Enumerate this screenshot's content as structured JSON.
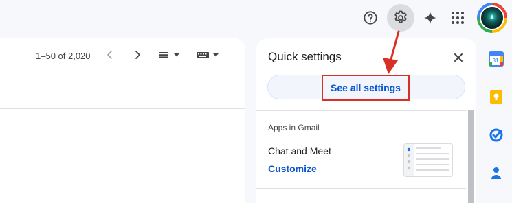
{
  "header": {
    "help_icon": "help-circle-icon",
    "settings_icon": "gear-icon",
    "gemini_icon": "sparkle-icon",
    "apps_icon": "apps-grid-icon",
    "avatar_icon": "account-avatar"
  },
  "toolbar": {
    "pagination": "1–50 of 2,020",
    "prev_icon": "chevron-left-icon",
    "next_icon": "chevron-right-icon",
    "density_icon": "density-menu-icon",
    "keyboard_icon": "keyboard-icon"
  },
  "quick_settings": {
    "title": "Quick settings",
    "see_all_label": "See all settings",
    "section_label": "Apps in Gmail",
    "chat_meet_label": "Chat and Meet",
    "customize_label": "Customize"
  },
  "side_rail": {
    "items": [
      "calendar-icon",
      "keep-icon",
      "tasks-icon",
      "contacts-icon"
    ],
    "calendar_day": "31"
  },
  "colors": {
    "annotation_red": "#d93025",
    "link_blue": "#0b57d0",
    "page_bg": "#f6f8fc"
  }
}
